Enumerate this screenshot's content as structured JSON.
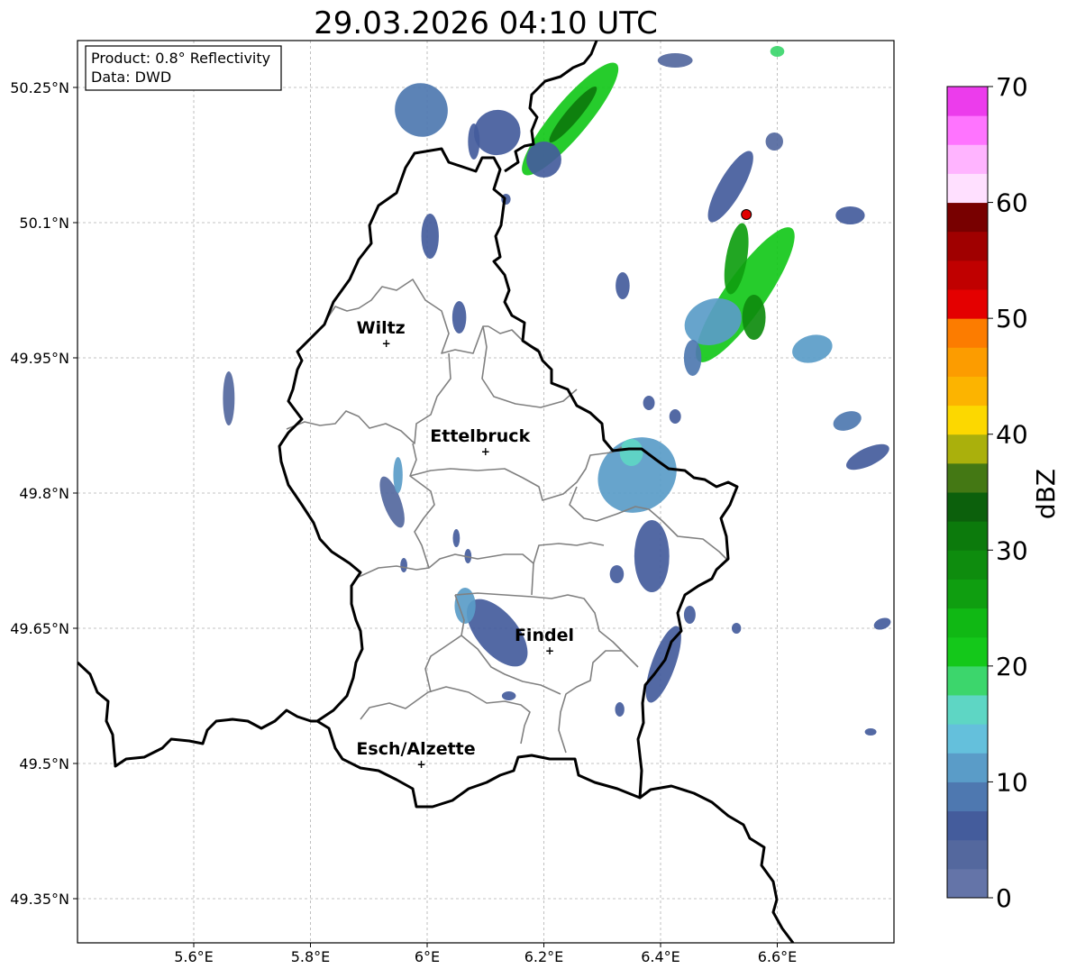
{
  "title": "29.03.2026 04:10 UTC",
  "info_box": {
    "product": "Product: 0.8° Reflectivity",
    "data": "Data: DWD"
  },
  "map": {
    "lon_range": [
      5.4,
      6.8
    ],
    "lat_range": [
      49.3,
      50.3
    ],
    "x_ticks": [
      {
        "value": 5.6,
        "label": "5.6°E"
      },
      {
        "value": 5.8,
        "label": "5.8°E"
      },
      {
        "value": 6.0,
        "label": "6°E"
      },
      {
        "value": 6.2,
        "label": "6.2°E"
      },
      {
        "value": 6.4,
        "label": "6.4°E"
      },
      {
        "value": 6.6,
        "label": "6.6°E"
      }
    ],
    "y_ticks": [
      {
        "value": 50.25,
        "label": "50.25°N"
      },
      {
        "value": 50.1,
        "label": "50.1°N"
      },
      {
        "value": 49.95,
        "label": "49.95°N"
      },
      {
        "value": 49.8,
        "label": "49.8°N"
      },
      {
        "value": 49.65,
        "label": "49.65°N"
      },
      {
        "value": 49.5,
        "label": "49.5°N"
      },
      {
        "value": 49.35,
        "label": "49.35°N"
      }
    ],
    "gridlines": true,
    "cities": [
      {
        "name": "Wiltz",
        "lon": 5.93,
        "lat": 49.967
      },
      {
        "name": "Ettelbruck",
        "lon": 6.1,
        "lat": 49.847
      },
      {
        "name": "Findel",
        "lon": 6.21,
        "lat": 49.626
      },
      {
        "name": "Esch/Alzette",
        "lon": 5.99,
        "lat": 49.5
      }
    ],
    "marker": {
      "lon": 6.547,
      "lat": 50.109,
      "color": "#e00000"
    }
  },
  "colorbar": {
    "label": "dBZ",
    "min": 0,
    "max": 70,
    "step": 2.5,
    "tick_labels": [
      "0",
      "10",
      "20",
      "30",
      "40",
      "50",
      "60",
      "70"
    ],
    "colors": [
      "#6474a8",
      "#54689e",
      "#445c9c",
      "#4e78b0",
      "#5a9cc8",
      "#64c0dc",
      "#5ed6c4",
      "#3cd66c",
      "#14c81a",
      "#10b814",
      "#0f9e10",
      "#0e8c0e",
      "#0c7a0c",
      "#0c600c",
      "#447814",
      "#aab00c",
      "#fcd800",
      "#fcb400",
      "#fc9c00",
      "#fc7c00",
      "#e40000",
      "#c00000",
      "#a00000",
      "#780000",
      "#ffe0ff",
      "#ffb4ff",
      "#ff74ff",
      "#ec3cec"
    ]
  },
  "radar_echoes": [
    {
      "lon": 6.545,
      "lat": 50.02,
      "rx": 0.035,
      "ry": 0.09,
      "rot": 35,
      "dbz": 20
    },
    {
      "lon": 6.53,
      "lat": 50.06,
      "rx": 0.018,
      "ry": 0.04,
      "rot": 10,
      "dbz": 25
    },
    {
      "lon": 6.56,
      "lat": 49.995,
      "rx": 0.02,
      "ry": 0.025,
      "rot": 0,
      "dbz": 28
    },
    {
      "lon": 6.49,
      "lat": 49.99,
      "rx": 0.05,
      "ry": 0.025,
      "rot": -20,
      "dbz": 10
    },
    {
      "lon": 6.455,
      "lat": 49.95,
      "rx": 0.015,
      "ry": 0.02,
      "rot": 0,
      "dbz": 8
    },
    {
      "lon": 6.52,
      "lat": 50.14,
      "rx": 0.02,
      "ry": 0.045,
      "rot": 30,
      "dbz": 6
    },
    {
      "lon": 6.595,
      "lat": 50.19,
      "rx": 0.015,
      "ry": 0.01,
      "rot": 0,
      "dbz": 4
    },
    {
      "lon": 6.245,
      "lat": 50.215,
      "rx": 0.03,
      "ry": 0.08,
      "rot": 40,
      "dbz": 22
    },
    {
      "lon": 6.25,
      "lat": 50.22,
      "rx": 0.012,
      "ry": 0.04,
      "rot": 40,
      "dbz": 30
    },
    {
      "lon": 6.2,
      "lat": 50.17,
      "rx": 0.03,
      "ry": 0.02,
      "rot": 0,
      "dbz": 6
    },
    {
      "lon": 5.99,
      "lat": 50.225,
      "rx": 0.045,
      "ry": 0.03,
      "rot": -30,
      "dbz": 8
    },
    {
      "lon": 6.12,
      "lat": 50.2,
      "rx": 0.04,
      "ry": 0.025,
      "rot": -20,
      "dbz": 5
    },
    {
      "lon": 6.36,
      "lat": 49.82,
      "rx": 0.07,
      "ry": 0.04,
      "rot": -35,
      "dbz": 12
    },
    {
      "lon": 6.35,
      "lat": 49.845,
      "rx": 0.02,
      "ry": 0.015,
      "rot": 0,
      "dbz": 16
    },
    {
      "lon": 6.385,
      "lat": 49.73,
      "rx": 0.03,
      "ry": 0.04,
      "rot": 0,
      "dbz": 7
    },
    {
      "lon": 6.405,
      "lat": 49.61,
      "rx": 0.02,
      "ry": 0.045,
      "rot": 20,
      "dbz": 6
    },
    {
      "lon": 6.12,
      "lat": 49.645,
      "rx": 0.035,
      "ry": 0.045,
      "rot": -40,
      "dbz": 5
    },
    {
      "lon": 6.065,
      "lat": 49.675,
      "rx": 0.018,
      "ry": 0.02,
      "rot": 0,
      "dbz": 12
    },
    {
      "lon": 5.94,
      "lat": 49.79,
      "rx": 0.015,
      "ry": 0.03,
      "rot": -20,
      "dbz": 4
    },
    {
      "lon": 5.95,
      "lat": 49.82,
      "rx": 0.008,
      "ry": 0.02,
      "rot": 0,
      "dbz": 10
    },
    {
      "lon": 6.005,
      "lat": 50.085,
      "rx": 0.015,
      "ry": 0.025,
      "rot": 0,
      "dbz": 5
    },
    {
      "lon": 6.055,
      "lat": 49.995,
      "rx": 0.012,
      "ry": 0.018,
      "rot": 0,
      "dbz": 5
    },
    {
      "lon": 5.66,
      "lat": 49.905,
      "rx": 0.01,
      "ry": 0.03,
      "rot": 0,
      "dbz": 4
    },
    {
      "lon": 6.66,
      "lat": 49.96,
      "rx": 0.035,
      "ry": 0.015,
      "rot": -15,
      "dbz": 10
    },
    {
      "lon": 6.72,
      "lat": 49.88,
      "rx": 0.025,
      "ry": 0.01,
      "rot": -20,
      "dbz": 8
    },
    {
      "lon": 6.755,
      "lat": 49.84,
      "rx": 0.04,
      "ry": 0.01,
      "rot": -25,
      "dbz": 5
    },
    {
      "lon": 6.725,
      "lat": 50.108,
      "rx": 0.025,
      "ry": 0.01,
      "rot": 0,
      "dbz": 5
    },
    {
      "lon": 6.6,
      "lat": 50.29,
      "rx": 0.012,
      "ry": 0.006,
      "rot": 0,
      "dbz": 18
    },
    {
      "lon": 6.425,
      "lat": 50.28,
      "rx": 0.03,
      "ry": 0.008,
      "rot": 0,
      "dbz": 4
    },
    {
      "lon": 6.335,
      "lat": 50.03,
      "rx": 0.012,
      "ry": 0.015,
      "rot": 0,
      "dbz": 5
    },
    {
      "lon": 6.38,
      "lat": 49.9,
      "rx": 0.01,
      "ry": 0.008,
      "rot": 0,
      "dbz": 5
    },
    {
      "lon": 6.425,
      "lat": 49.885,
      "rx": 0.01,
      "ry": 0.008,
      "rot": 0,
      "dbz": 5
    },
    {
      "lon": 6.325,
      "lat": 49.71,
      "rx": 0.012,
      "ry": 0.01,
      "rot": 0,
      "dbz": 5
    },
    {
      "lon": 6.45,
      "lat": 49.665,
      "rx": 0.01,
      "ry": 0.01,
      "rot": 0,
      "dbz": 5
    },
    {
      "lon": 6.53,
      "lat": 49.65,
      "rx": 0.008,
      "ry": 0.006,
      "rot": 0,
      "dbz": 5
    },
    {
      "lon": 6.05,
      "lat": 49.75,
      "rx": 0.006,
      "ry": 0.01,
      "rot": 0,
      "dbz": 5
    },
    {
      "lon": 6.07,
      "lat": 49.73,
      "rx": 0.006,
      "ry": 0.008,
      "rot": 0,
      "dbz": 5
    },
    {
      "lon": 5.96,
      "lat": 49.72,
      "rx": 0.006,
      "ry": 0.008,
      "rot": 0,
      "dbz": 5
    },
    {
      "lon": 6.14,
      "lat": 49.575,
      "rx": 0.012,
      "ry": 0.005,
      "rot": 0,
      "dbz": 5
    },
    {
      "lon": 6.33,
      "lat": 49.56,
      "rx": 0.008,
      "ry": 0.008,
      "rot": 0,
      "dbz": 5
    },
    {
      "lon": 6.78,
      "lat": 49.655,
      "rx": 0.015,
      "ry": 0.006,
      "rot": -20,
      "dbz": 6
    },
    {
      "lon": 6.76,
      "lat": 49.535,
      "rx": 0.01,
      "ry": 0.004,
      "rot": 0,
      "dbz": 5
    },
    {
      "lon": 6.135,
      "lat": 50.126,
      "rx": 0.008,
      "ry": 0.006,
      "rot": 0,
      "dbz": 5
    },
    {
      "lon": 6.08,
      "lat": 50.19,
      "rx": 0.01,
      "ry": 0.02,
      "rot": 0,
      "dbz": 5
    }
  ]
}
